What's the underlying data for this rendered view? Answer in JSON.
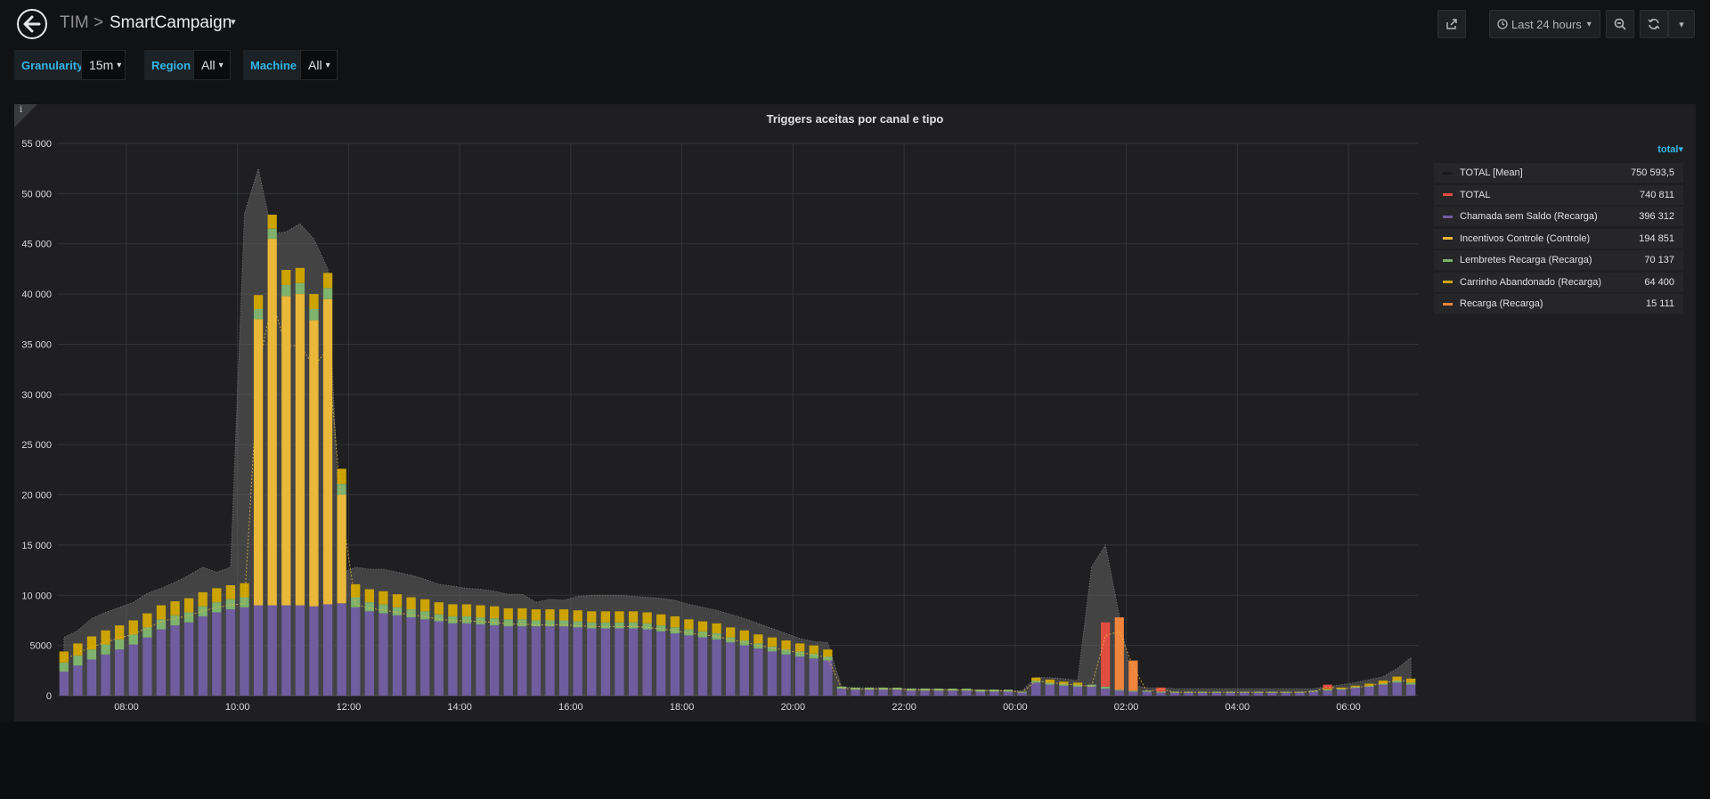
{
  "header": {
    "org": "TIM",
    "separator": ">",
    "dashboard": "SmartCampaign",
    "time_range_label": "Last 24 hours"
  },
  "icons": {
    "back": "arrow-left-icon",
    "share": "share-icon",
    "clock": "clock-icon",
    "zoom": "zoom-out-icon",
    "refresh": "refresh-icon",
    "caret": "caret-down-icon"
  },
  "variables": [
    {
      "label": "Granularity",
      "value": "15m"
    },
    {
      "label": "Region",
      "value": "All"
    },
    {
      "label": "Machine",
      "value": "All"
    }
  ],
  "panel": {
    "legend_sort_label": "total",
    "legend": [
      {
        "name": "TOTAL [Mean]",
        "value": "750 593,5",
        "color": "#1a1a1a"
      },
      {
        "name": "TOTAL",
        "value": "740 811",
        "color": "#e24d42"
      },
      {
        "name": "Chamada sem Saldo (Recarga)",
        "value": "396 312",
        "color": "#705da0"
      },
      {
        "name": "Incentivos Controle (Controle)",
        "value": "194 851",
        "color": "#eab839"
      },
      {
        "name": "Lembretes Recarga (Recarga)",
        "value": "70 137",
        "color": "#7eb26d"
      },
      {
        "name": "Carrinho Abandonado (Recarga)",
        "value": "64 400",
        "color": "#cca300"
      },
      {
        "name": "Recarga (Recarga)",
        "value": "15 111",
        "color": "#ef843c"
      }
    ]
  },
  "chart_data": {
    "type": "bar",
    "title": "Triggers aceitas por canal e tipo",
    "stacked": true,
    "ylim": [
      0,
      55000
    ],
    "yticks": [
      0,
      5000,
      10000,
      15000,
      20000,
      25000,
      30000,
      35000,
      40000,
      45000,
      50000,
      55000
    ],
    "ytick_labels": [
      "0",
      "5000",
      "10 000",
      "15 000",
      "20 000",
      "25 000",
      "30 000",
      "35 000",
      "40 000",
      "45 000",
      "50 000",
      "55 000"
    ],
    "xtick_labels": [
      "08:00",
      "10:00",
      "12:00",
      "14:00",
      "16:00",
      "18:00",
      "20:00",
      "22:00",
      "00:00",
      "02:00",
      "04:00",
      "06:00"
    ],
    "grid": true,
    "legend_placement": "right",
    "start_time": "06:45",
    "interval_minutes": 15,
    "series": [
      {
        "name": "Chamada sem Saldo (Recarga)",
        "color": "#705da0",
        "values": [
          2400,
          3000,
          3600,
          4100,
          4600,
          5100,
          5800,
          6600,
          7000,
          7300,
          7900,
          8300,
          8600,
          8800,
          9000,
          9000,
          9000,
          9000,
          8900,
          9100,
          9200,
          8800,
          8400,
          8200,
          8000,
          7800,
          7600,
          7400,
          7200,
          7200,
          7100,
          7000,
          6900,
          6900,
          6900,
          6900,
          6900,
          6800,
          6700,
          6700,
          6700,
          6700,
          6600,
          6400,
          6200,
          6000,
          5800,
          5600,
          5300,
          5000,
          4700,
          4400,
          4100,
          3900,
          3700,
          3500,
          700,
          600,
          600,
          600,
          600,
          500,
          500,
          500,
          500,
          500,
          400,
          400,
          400,
          300,
          1300,
          1100,
          1000,
          900,
          900,
          700,
          500,
          400,
          400,
          300,
          300,
          300,
          300,
          300,
          300,
          300,
          300,
          300,
          300,
          300,
          400,
          500,
          600,
          800,
          900,
          1100,
          1300,
          1100
        ]
      },
      {
        "name": "Incentivos Controle (Controle)",
        "color": "#eab839",
        "values": [
          0,
          0,
          0,
          0,
          0,
          0,
          0,
          0,
          0,
          0,
          0,
          0,
          0,
          0,
          28500,
          36500,
          30800,
          31000,
          28500,
          30400,
          10800,
          0,
          0,
          0,
          0,
          0,
          0,
          0,
          0,
          0,
          0,
          0,
          0,
          0,
          0,
          0,
          0,
          0,
          0,
          0,
          0,
          0,
          0,
          0,
          0,
          0,
          0,
          0,
          0,
          0,
          0,
          0,
          0,
          0,
          0,
          0,
          0,
          0,
          0,
          0,
          0,
          0,
          0,
          0,
          0,
          0,
          0,
          0,
          0,
          0,
          0,
          0,
          0,
          0,
          0,
          0,
          0,
          0,
          0,
          0,
          0,
          0,
          0,
          0,
          0,
          0,
          0,
          0,
          0,
          0,
          0,
          0,
          0,
          0,
          0,
          0,
          0,
          0
        ]
      },
      {
        "name": "Lembretes Recarga (Recarga)",
        "color": "#7eb26d",
        "values": [
          900,
          1000,
          1000,
          1000,
          1000,
          1000,
          1000,
          1000,
          1000,
          1000,
          1000,
          1000,
          1000,
          1000,
          1000,
          1000,
          1100,
          1100,
          1100,
          1100,
          1100,
          1000,
          900,
          900,
          800,
          800,
          800,
          700,
          700,
          700,
          700,
          700,
          700,
          700,
          600,
          600,
          600,
          600,
          600,
          600,
          600,
          600,
          600,
          600,
          600,
          600,
          600,
          600,
          500,
          500,
          500,
          500,
          500,
          500,
          500,
          400,
          200,
          200,
          200,
          200,
          200,
          200,
          200,
          200,
          200,
          200,
          200,
          200,
          200,
          100,
          200,
          200,
          200,
          200,
          200,
          200,
          100,
          100,
          100,
          100,
          100,
          100,
          100,
          100,
          100,
          100,
          100,
          100,
          100,
          100,
          100,
          100,
          100,
          100,
          100,
          100,
          200,
          200
        ]
      },
      {
        "name": "Carrinho Abandonado (Recarga)",
        "color": "#cca300",
        "values": [
          1100,
          1200,
          1300,
          1400,
          1400,
          1400,
          1400,
          1400,
          1400,
          1400,
          1400,
          1400,
          1400,
          1400,
          1400,
          1400,
          1500,
          1500,
          1500,
          1500,
          1500,
          1300,
          1300,
          1300,
          1300,
          1200,
          1200,
          1200,
          1200,
          1200,
          1200,
          1200,
          1100,
          1100,
          1100,
          1100,
          1100,
          1100,
          1100,
          1100,
          1100,
          1100,
          1100,
          1100,
          1100,
          1000,
          1000,
          1000,
          1000,
          1000,
          900,
          900,
          900,
          800,
          800,
          700,
          0,
          0,
          0,
          0,
          0,
          0,
          0,
          0,
          0,
          0,
          0,
          0,
          0,
          0,
          300,
          300,
          200,
          200,
          0,
          0,
          0,
          0,
          0,
          0,
          0,
          0,
          0,
          0,
          0,
          0,
          0,
          0,
          0,
          0,
          0,
          100,
          100,
          100,
          200,
          300,
          400,
          400
        ]
      },
      {
        "name": "Recarga (Recarga)",
        "color": "#ef843c",
        "values": [
          0,
          0,
          0,
          0,
          0,
          0,
          0,
          0,
          0,
          0,
          0,
          0,
          0,
          0,
          0,
          0,
          0,
          0,
          0,
          0,
          0,
          0,
          0,
          0,
          0,
          0,
          0,
          0,
          0,
          0,
          0,
          0,
          0,
          0,
          0,
          0,
          0,
          0,
          0,
          0,
          0,
          0,
          0,
          0,
          0,
          0,
          0,
          0,
          0,
          0,
          0,
          0,
          0,
          0,
          0,
          0,
          0,
          0,
          0,
          0,
          0,
          0,
          0,
          0,
          0,
          0,
          0,
          0,
          0,
          0,
          0,
          0,
          0,
          0,
          0,
          0,
          7200,
          3000,
          0,
          0,
          0,
          0,
          0,
          0,
          0,
          0,
          0,
          0,
          0,
          0,
          0,
          0,
          0,
          0,
          0,
          0,
          0,
          0
        ]
      },
      {
        "name": "TOTAL",
        "color": "#e24d42",
        "values": [
          0,
          0,
          0,
          0,
          0,
          0,
          0,
          0,
          0,
          0,
          0,
          0,
          0,
          0,
          0,
          0,
          0,
          0,
          0,
          0,
          0,
          0,
          0,
          0,
          0,
          0,
          0,
          0,
          0,
          0,
          0,
          0,
          0,
          0,
          0,
          0,
          0,
          0,
          0,
          0,
          0,
          0,
          0,
          0,
          0,
          0,
          0,
          0,
          0,
          0,
          0,
          0,
          0,
          0,
          0,
          0,
          0,
          0,
          0,
          0,
          0,
          0,
          0,
          0,
          0,
          0,
          0,
          0,
          0,
          0,
          0,
          0,
          0,
          0,
          0,
          6400,
          0,
          0,
          0,
          400,
          0,
          0,
          0,
          0,
          0,
          0,
          0,
          0,
          0,
          0,
          0,
          400,
          0,
          0,
          0,
          0,
          0,
          0
        ]
      }
    ],
    "mean_area": {
      "name": "TOTAL [Mean]",
      "values": [
        5800,
        6500,
        7700,
        8300,
        8800,
        9300,
        10200,
        10700,
        11300,
        12000,
        12800,
        12300,
        12800,
        48000,
        52500,
        46000,
        46200,
        47000,
        45500,
        42500,
        12200,
        12800,
        12600,
        12600,
        12300,
        12000,
        11600,
        11100,
        10900,
        10700,
        10600,
        10400,
        10100,
        10100,
        9300,
        9600,
        9500,
        9900,
        10000,
        10000,
        10000,
        9900,
        9800,
        9700,
        9500,
        9100,
        8800,
        8500,
        8100,
        7700,
        7200,
        6700,
        6200,
        5700,
        5400,
        5300,
        900,
        800,
        800,
        800,
        700,
        700,
        700,
        700,
        600,
        600,
        600,
        600,
        500,
        500,
        1800,
        1800,
        1700,
        1500,
        12800,
        15000,
        8000,
        1000,
        800,
        800,
        700,
        700,
        700,
        700,
        700,
        700,
        700,
        700,
        700,
        700,
        700,
        900,
        1100,
        1300,
        1600,
        1900,
        2700,
        3800
      ]
    }
  }
}
